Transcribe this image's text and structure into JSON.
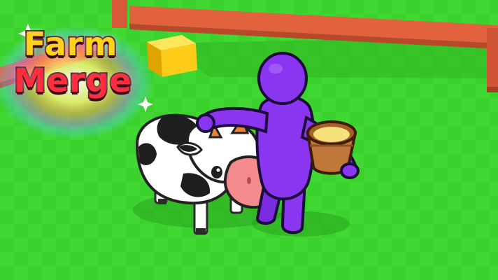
{
  "logo": {
    "word_1": "Farm",
    "word_2": "Merge"
  },
  "colors": {
    "grass": "#3cd22e",
    "grass_dark": "#2fb723",
    "fence": "#e2623d",
    "character": "#8a35f0",
    "hay_block": "#ffd21c",
    "cow_nose": "#f28a8e",
    "logo_word_1": "#ffd21c",
    "logo_word_2": "#ff2f3f"
  },
  "icons": [
    "sparkle-icon",
    "rainbow-glow"
  ]
}
